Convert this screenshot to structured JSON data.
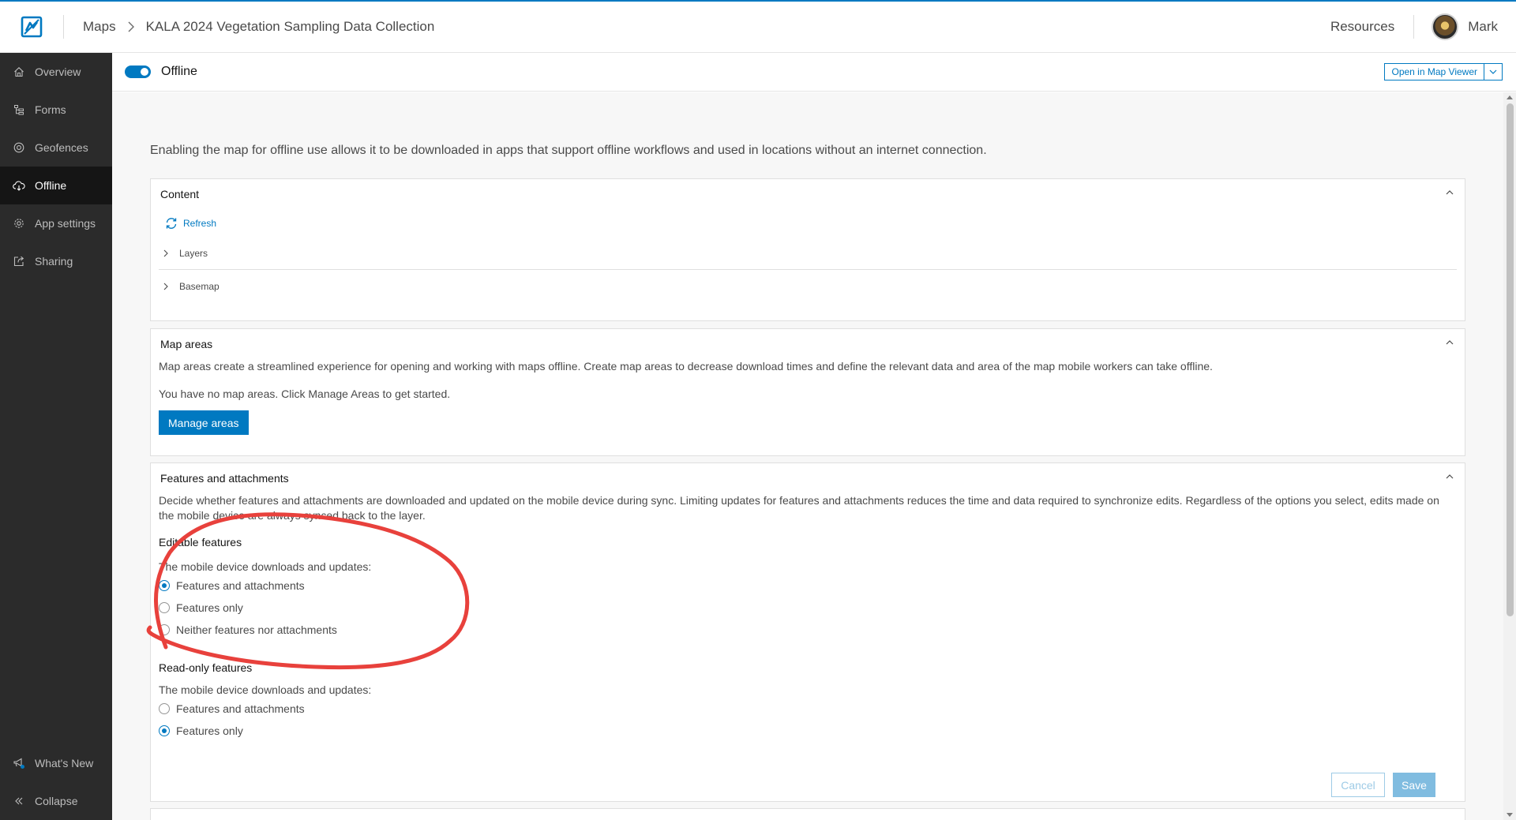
{
  "header": {
    "breadcrumb": [
      "Maps",
      "KALA 2024 Vegetation Sampling Data Collection"
    ],
    "resources_label": "Resources",
    "user_name": "Mark"
  },
  "sidebar": {
    "items": [
      {
        "label": "Overview",
        "icon": "home-icon"
      },
      {
        "label": "Forms",
        "icon": "forms-icon"
      },
      {
        "label": "Geofences",
        "icon": "geofence-icon"
      },
      {
        "label": "Offline",
        "icon": "offline-cloud-icon",
        "active": true
      },
      {
        "label": "App settings",
        "icon": "gear-icon"
      },
      {
        "label": "Sharing",
        "icon": "share-icon"
      }
    ],
    "bottom": [
      {
        "label": "What's New",
        "icon": "megaphone-icon"
      },
      {
        "label": "Collapse",
        "icon": "collapse-icon"
      }
    ]
  },
  "toolbar": {
    "toggle_label": "Offline",
    "toggle_on": true,
    "open_map_viewer": "Open in Map Viewer"
  },
  "intro": "Enabling the map for offline use allows it to be downloaded in apps that support offline workflows and used in locations without an internet connection.",
  "content_panel": {
    "title": "Content",
    "refresh_label": "Refresh",
    "rows": [
      "Layers",
      "Basemap"
    ]
  },
  "map_areas": {
    "title": "Map areas",
    "description": "Map areas create a streamlined experience for opening and working with maps offline. Create map areas to decrease download times and define the relevant data and area of the map mobile workers can take offline.",
    "empty_text": "You have no map areas. Click Manage Areas to get started.",
    "button_label": "Manage areas"
  },
  "features": {
    "title": "Features and attachments",
    "description": "Decide whether features and attachments are downloaded and updated on the mobile device during sync. Limiting updates for features and attachments reduces the time and data required to synchronize edits. Regardless of the options you select, edits made on the mobile device are always synced back to the layer.",
    "editable": {
      "heading": "Editable features",
      "prompt": "The mobile device downloads and updates:",
      "options": [
        "Features and attachments",
        "Features only",
        "Neither features nor attachments"
      ],
      "selected": 0
    },
    "readonly": {
      "heading": "Read-only features",
      "prompt": "The mobile device downloads and updates:",
      "options": [
        "Features and attachments",
        "Features only"
      ],
      "selected": 1
    },
    "cancel_label": "Cancel",
    "save_label": "Save"
  },
  "colors": {
    "brand": "#0079c1",
    "sidebar_bg": "#2b2b2b",
    "annotation": "#e8413c"
  }
}
